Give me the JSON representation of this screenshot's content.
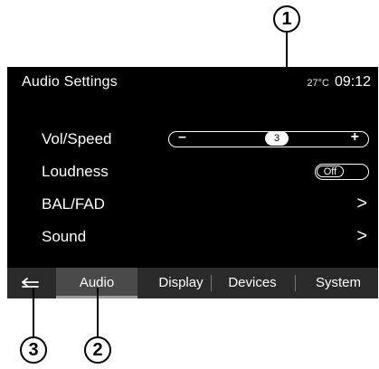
{
  "header": {
    "title": "Audio Settings",
    "temperature": "27°C",
    "time": "09:12"
  },
  "settings": {
    "vol_speed": {
      "label": "Vol/Speed",
      "minus_symbol": "–",
      "plus_symbol": "+",
      "value": "3",
      "level_fraction": 0.55
    },
    "loudness": {
      "label": "Loudness",
      "state": "Off"
    },
    "bal_fad": {
      "label": "BAL/FAD",
      "chevron": ">"
    },
    "sound": {
      "label": "Sound",
      "chevron": ">"
    }
  },
  "tabs": [
    {
      "label": "Audio",
      "active": true
    },
    {
      "label": "Display",
      "active": false
    },
    {
      "label": "Devices",
      "active": false
    },
    {
      "label": "System",
      "active": false
    }
  ],
  "back_icon": "back-arrow-icon",
  "callouts": {
    "c1": "1",
    "c2": "2",
    "c3": "3"
  },
  "colors": {
    "screen_bg": "#000000",
    "tab_bar_bg": "#2a2a2a",
    "active_tab_bg": "#4a4a4a",
    "text": "#ffffff"
  }
}
